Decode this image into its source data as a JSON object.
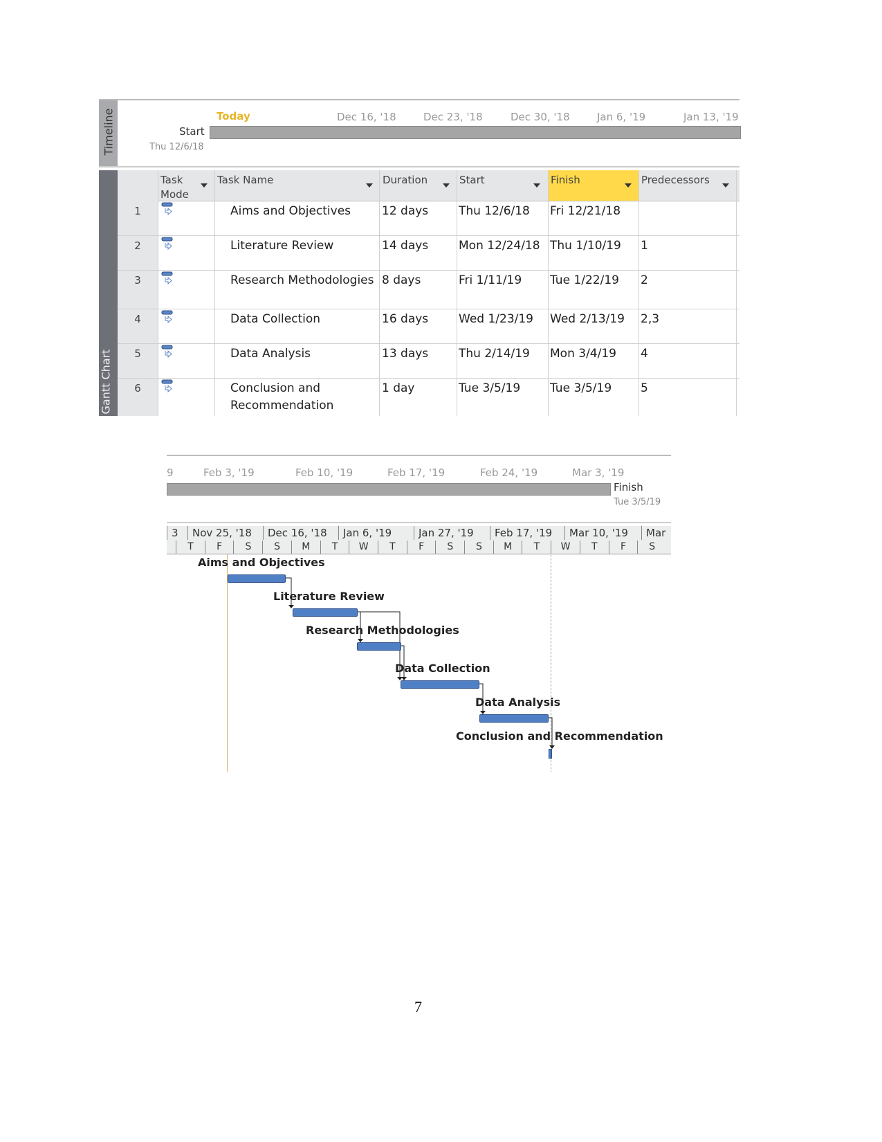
{
  "timeline_top": {
    "side_label": "Timeline",
    "today_label": "Today",
    "start_label": "Start",
    "start_date": "Thu 12/6/18",
    "ticks": [
      "Dec 16, '18",
      "Dec 23, '18",
      "Dec 30, '18",
      "Jan 6, '19",
      "Jan 13, '19"
    ]
  },
  "table": {
    "side_label": "Gantt Chart",
    "columns": [
      "Task Mode",
      "Task Name",
      "Duration",
      "Start",
      "Finish",
      "Predecessors"
    ],
    "rows": [
      {
        "id": "1",
        "name": "Aims and Objectives",
        "duration": "12 days",
        "start": "Thu 12/6/18",
        "finish": "Fri 12/21/18",
        "pred": ""
      },
      {
        "id": "2",
        "name": "Literature Review",
        "duration": "14 days",
        "start": "Mon 12/24/18",
        "finish": "Thu 1/10/19",
        "pred": "1"
      },
      {
        "id": "3",
        "name": "Research Methodologies",
        "duration": "8 days",
        "start": "Fri 1/11/19",
        "finish": "Tue 1/22/19",
        "pred": "2"
      },
      {
        "id": "4",
        "name": "Data Collection",
        "duration": "16 days",
        "start": "Wed 1/23/19",
        "finish": "Wed 2/13/19",
        "pred": "2,3"
      },
      {
        "id": "5",
        "name": "Data Analysis",
        "duration": "13 days",
        "start": "Thu 2/14/19",
        "finish": "Mon 3/4/19",
        "pred": "4"
      },
      {
        "id": "6",
        "name": "Conclusion and Recommendation",
        "duration": "1 day",
        "start": "Tue 3/5/19",
        "finish": "Tue 3/5/19",
        "pred": "5"
      }
    ],
    "highlight_color": "#ffd94a"
  },
  "timeline_bottom": {
    "ticks": [
      "9",
      "Feb 3, '19",
      "Feb 10, '19",
      "Feb 17, '19",
      "Feb 24, '19",
      "Mar 3, '19"
    ],
    "finish_label": "Finish",
    "finish_date": "Tue 3/5/19"
  },
  "gantt": {
    "top_scale": [
      "3",
      "Nov 25, '18",
      "Dec 16, '18",
      "Jan 6, '19",
      "Jan 27, '19",
      "Feb 17, '19",
      "Mar 10, '19",
      "Mar"
    ],
    "bottom_scale": [
      "T",
      "F",
      "S",
      "S",
      "M",
      "T",
      "W",
      "T",
      "F",
      "S",
      "S",
      "M",
      "T",
      "W",
      "T",
      "F",
      "S"
    ],
    "bar_labels": [
      "Aims and Objectives",
      "Literature Review",
      "Research Methodologies",
      "Data Collection",
      "Data Analysis",
      "Conclusion and Recommendation"
    ],
    "bar_color": "#4f7fc4"
  },
  "page_number": "7"
}
